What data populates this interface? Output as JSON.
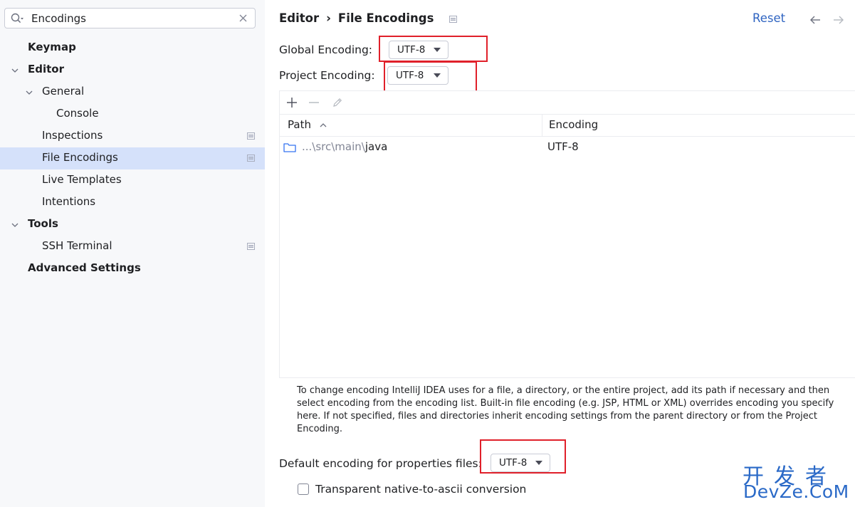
{
  "search": {
    "value": "Encodings"
  },
  "tree": {
    "keymap": "Keymap",
    "editor": "Editor",
    "general": "General",
    "console": "Console",
    "inspections": "Inspections",
    "file_encodings": "File Encodings",
    "live_templates": "Live Templates",
    "intentions": "Intentions",
    "tools": "Tools",
    "ssh_terminal": "SSH Terminal",
    "advanced_settings": "Advanced Settings"
  },
  "header": {
    "crumb_parent": "Editor",
    "crumb_separator": "›",
    "crumb_current": "File Encodings",
    "reset": "Reset"
  },
  "encoding": {
    "global_label": "Global Encoding:",
    "global_value": "UTF-8",
    "project_label": "Project Encoding:",
    "project_value": "UTF-8"
  },
  "table": {
    "col_path": "Path",
    "col_encoding": "Encoding",
    "rows": [
      {
        "path_prefix": "...\\src\\main\\",
        "path_name": "java",
        "encoding": "UTF-8"
      }
    ]
  },
  "help_text": "To change encoding IntelliJ IDEA uses for a file, a directory, or the entire project, add its path if necessary and then select encoding from the encoding list. Built-in file encoding (e.g. JSP, HTML or XML) overrides encoding you specify here. If not specified, files and directories inherit encoding settings from the parent directory or from the Project Encoding.",
  "properties": {
    "label": "Default encoding for properties files:",
    "value": "UTF-8"
  },
  "native_to_ascii": {
    "label": "Transparent native-to-ascii conversion",
    "checked": false
  },
  "watermark": {
    "line1": "开发者",
    "line2": "DevZe.CoM"
  },
  "colors": {
    "selection": "#d5e1fa",
    "link": "#2f64c1",
    "highlight_box": "#e0202a",
    "watermark": "#2a69c7"
  }
}
